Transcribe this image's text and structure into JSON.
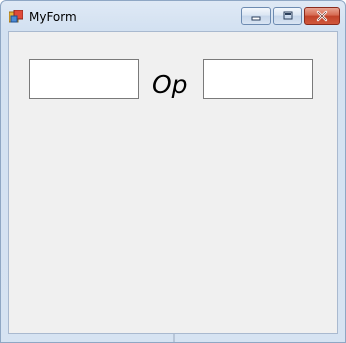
{
  "window": {
    "title": "MyForm",
    "icon": "winform-app-icon"
  },
  "caption_buttons": {
    "minimize": "minimize-icon",
    "maximize": "maximize-icon",
    "close": "close-icon"
  },
  "form": {
    "left_input_value": "",
    "operator_label": "Op",
    "right_input_value": ""
  },
  "colors": {
    "title_bar": "#d3e1f1",
    "client_background": "#f0f0f0",
    "close_button": "#c1432a"
  }
}
